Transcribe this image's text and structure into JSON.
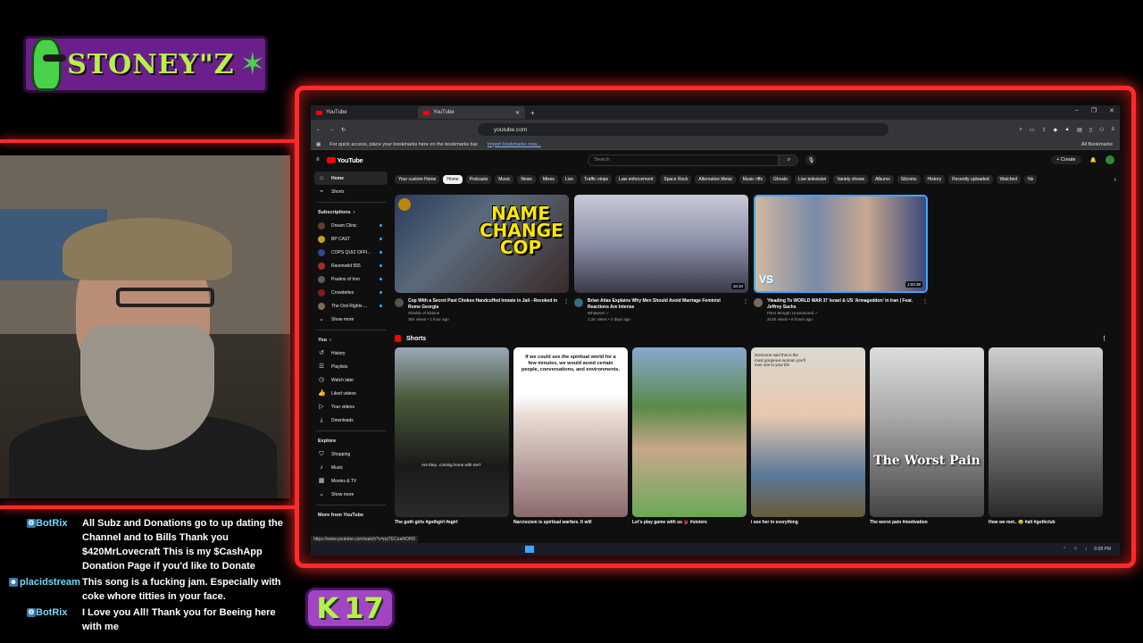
{
  "overlay": {
    "logo_text": "STONEY\"Z",
    "level_badge": "17",
    "chat": [
      {
        "user": "BotRix",
        "text": "All Subz and Donations go to up dating the Channel and to Bills Thank you $420MrLovecraft This is my $CashApp Donation Page if you'd like to Donate"
      },
      {
        "user": "placidstream",
        "text": "This song is a fucking jam. Especially with coke whore titties in your face."
      },
      {
        "user": "BotRix",
        "text": "I Love you All! Thank you for Beeing here with me"
      }
    ]
  },
  "browser": {
    "tabs": [
      {
        "label": "YouTube"
      },
      {
        "label": "YouTube"
      }
    ],
    "url": "youtube.com",
    "bookmarks_text": "For quick access, place your bookmarks here on the bookmarks bar.",
    "bookmarks_link": "Import bookmarks now...",
    "all_bookmarks": "All Bookmarks",
    "status_url": "https://www.youtube.com/watch?v=pqTECeaNOHD"
  },
  "youtube": {
    "logo": "YouTube",
    "search_placeholder": "Search",
    "create_label": "+ Create",
    "sidebar": {
      "home": "Home",
      "shorts": "Shorts",
      "subscriptions": "Subscriptions",
      "channels": [
        "Dream Clinic",
        "BP CAST",
        "COPS QUIZ OFFI...",
        "Ravenwild 555",
        "Psalms of Iron",
        "Crowdettes",
        "The Onli Rights ..."
      ],
      "channel_colors": [
        "#6a3a2a",
        "#c8a020",
        "#2a4a8a",
        "#aa2a2a",
        "#5a5a5a",
        "#8a1a1a",
        "#7a6a5a"
      ],
      "show_more": "Show more",
      "you": "You",
      "you_items": [
        "History",
        "Playlists",
        "Watch later",
        "Liked videos",
        "Your videos",
        "Downloads"
      ],
      "explore": "Explore",
      "explore_items": [
        "Shopping",
        "Music",
        "Movies & TV"
      ],
      "more_from": "More from YouTube"
    },
    "chips": [
      "Your custom Home",
      "Home",
      "Podcasts",
      "Music",
      "News",
      "Mixes",
      "Live",
      "Traffic stops",
      "Law enforcement",
      "Space Rock",
      "Alternative Metal",
      "Music riffs",
      "Ghosts",
      "Live television",
      "Variety shows",
      "Albums",
      "Sitcoms",
      "History",
      "Recently uploaded",
      "Watched",
      "Ne"
    ],
    "videos": [
      {
        "thumb_text": "NAME CHANGE COP",
        "title": "Cop With a Secret Past Chokes Handcuffed Inmate in Jail - Revoked in Rome Georgia",
        "channel": "Shields of Shame",
        "stats": "364 views • 1 hour ago"
      },
      {
        "thumb_text": "",
        "duration": "18:10",
        "title": "Brian Atlas Explains Why Men Should Avoid Marriage Feminist Reactions Are Intense",
        "channel": "Whatever ✓",
        "stats": "1.1K views • 2 days ago"
      },
      {
        "thumb_text": "VS",
        "duration": "1:02:38",
        "title": "'Heading To WORLD WAR 3!' Israel & US 'Armageddon' in Iran | Feat. Jeffrey Sachs",
        "channel": "Piers Morgan Uncensored ✓",
        "stats": "312K views • 6 hours ago"
      }
    ],
    "shorts_label": "Shorts",
    "shorts": [
      {
        "title": "The goth girls #gothgirl #egirl",
        "overlay": "Are they...coming home with me?"
      },
      {
        "title": "Narcissism is spiritual warfare. It will",
        "overlay": "If we could see the spiritual world for a few minutes, we would avoid certain people, conversations, and environments."
      },
      {
        "title": "Let's play game with us 👙 #sisters",
        "overlay": ""
      },
      {
        "title": "i see her in everything",
        "overlay": "Someone said this is the most gorgeous woman you'll ever see in your life"
      },
      {
        "title": "The worst pain #motivation",
        "overlay": "The Worst Pain"
      },
      {
        "title": "How we met.. 😂 #alt #gothclub",
        "overlay": ""
      }
    ]
  },
  "taskbar": {
    "clock": "6:08 PM"
  }
}
